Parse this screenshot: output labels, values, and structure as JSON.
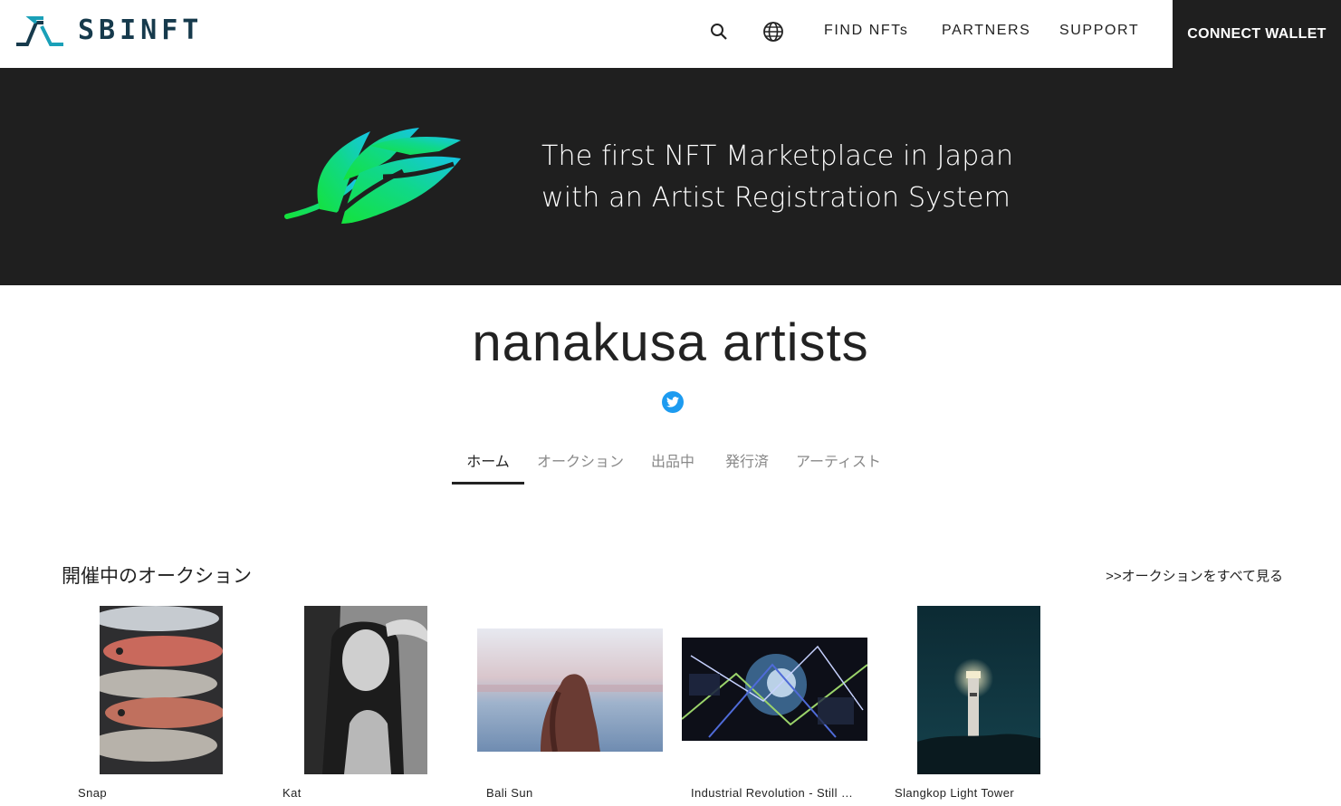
{
  "header": {
    "logo_text": "SBINFT",
    "nav": {
      "find": "FIND NFTs",
      "partners": "PARTNERS",
      "support": "SUPPORT"
    },
    "connect_label": "CONNECT WALLET",
    "icons": [
      "search-icon",
      "globe-icon"
    ]
  },
  "banner": {
    "line1": "The first NFT Marketplace in Japan",
    "line2": "with an Artist Registration System"
  },
  "artist": {
    "name": "nanakusa artists",
    "social_icon": "twitter-icon"
  },
  "tabs": [
    {
      "label": "ホーム",
      "active": true
    },
    {
      "label": "オークション",
      "active": false
    },
    {
      "label": "出品中",
      "active": false
    },
    {
      "label": "発行済",
      "active": false
    },
    {
      "label": "アーティスト",
      "active": false
    }
  ],
  "auction": {
    "title": "開催中のオークション",
    "see_all": ">>オークションをすべて見る",
    "items": [
      {
        "title": "Snap"
      },
      {
        "title": "Kat"
      },
      {
        "title": "Bali Sun"
      },
      {
        "title": "Industrial Revolution - Still …"
      },
      {
        "title": "Slangkop Light Tower"
      }
    ]
  },
  "colors": {
    "accent_dark": "#1f1f1f",
    "twitter": "#1d9bf0",
    "logo": "#163a4c"
  }
}
